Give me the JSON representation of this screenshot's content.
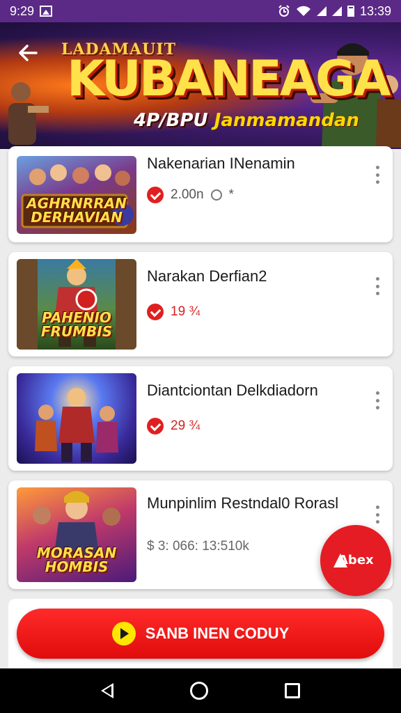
{
  "status_bar": {
    "time": "9:29",
    "clock": "13:39"
  },
  "banner": {
    "kicker": "LADAMAUIT",
    "title": "KUBANEAGA",
    "subtitle_a": "4P/BPU",
    "subtitle_b": "Janmamandan"
  },
  "games": [
    {
      "title": "Nakenarian INenamin",
      "thumb_caption": "AGHRNRRAN DERHAVIAN",
      "meta": [
        {
          "type": "red-dot"
        },
        {
          "text": "2.00n"
        },
        {
          "type": "clock"
        },
        {
          "text": "*"
        }
      ]
    },
    {
      "title": "Narakan Derfian2",
      "thumb_caption": "PAHENIO FRUMBIS",
      "meta": [
        {
          "type": "red-dot"
        },
        {
          "text": "19 ¾",
          "red": true
        }
      ]
    },
    {
      "title": "Diantciontan Delkdiadorn",
      "thumb_caption": "",
      "meta": [
        {
          "type": "red-dot"
        },
        {
          "text": "29 ¾",
          "red": true
        }
      ]
    },
    {
      "title": "Munpinlim Restndal0 Rorasl",
      "thumb_caption": "MORASAN HOMBIS",
      "meta": [
        {
          "text": "$ 3: 066: 13:510k"
        }
      ]
    }
  ],
  "fab": {
    "label": "Abex",
    "color": "#e51c23"
  },
  "cta": {
    "label": "SANB INEN CODUY",
    "color": "#e00c0c"
  },
  "colors": {
    "status_bar": "#5b2a86",
    "accent": "#e02020"
  }
}
